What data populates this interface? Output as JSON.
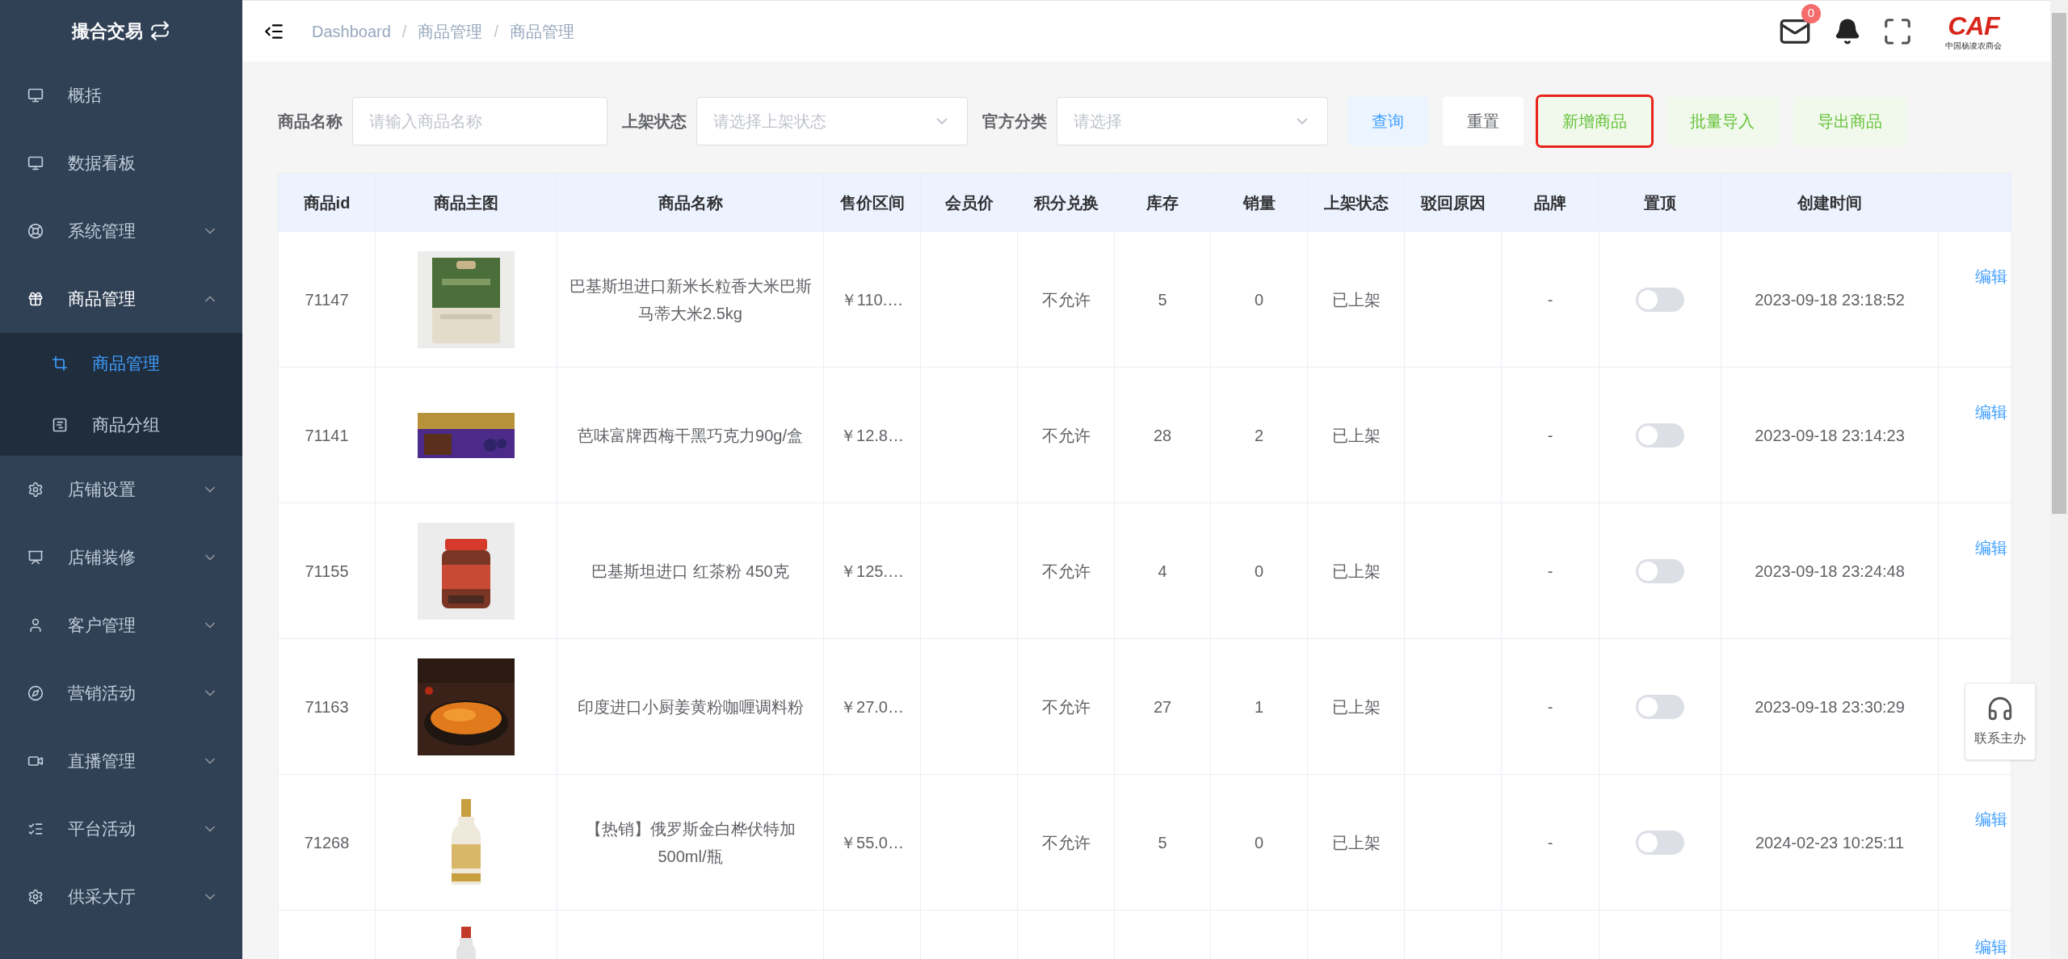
{
  "sidebar": {
    "title": "撮合交易",
    "items": [
      {
        "label": "概括",
        "expandable": false,
        "expanded": false
      },
      {
        "label": "数据看板",
        "expandable": false,
        "expanded": false
      },
      {
        "label": "系统管理",
        "expandable": true,
        "expanded": false
      },
      {
        "label": "商品管理",
        "expandable": true,
        "expanded": true,
        "children": [
          {
            "label": "商品管理",
            "selected": true
          },
          {
            "label": "商品分组",
            "selected": false
          }
        ]
      },
      {
        "label": "店铺设置",
        "expandable": true,
        "expanded": false
      },
      {
        "label": "店铺装修",
        "expandable": true,
        "expanded": false
      },
      {
        "label": "客户管理",
        "expandable": true,
        "expanded": false
      },
      {
        "label": "营销活动",
        "expandable": true,
        "expanded": false
      },
      {
        "label": "直播管理",
        "expandable": true,
        "expanded": false
      },
      {
        "label": "平台活动",
        "expandable": true,
        "expanded": false
      },
      {
        "label": "供采大厅",
        "expandable": true,
        "expanded": false
      }
    ]
  },
  "breadcrumb": {
    "separator": "/",
    "items": [
      "Dashboard",
      "商品管理",
      "商品管理"
    ]
  },
  "header": {
    "mail_badge": "0",
    "logo": "CAF",
    "logo_subtitle": "中国杨凌农商会"
  },
  "filters": [
    {
      "label": "商品名称",
      "placeholder": "请输入商品名称",
      "kind": "input"
    },
    {
      "label": "上架状态",
      "placeholder": "请选择上架状态",
      "kind": "select"
    },
    {
      "label": "官方分类",
      "placeholder": "请选择",
      "kind": "select"
    }
  ],
  "buttons": [
    {
      "label": "查询",
      "kind": "primary",
      "highlighted": false
    },
    {
      "label": "重置",
      "kind": "default",
      "highlighted": false
    },
    {
      "label": "新增商品",
      "kind": "success",
      "highlighted": true
    },
    {
      "label": "批量导入",
      "kind": "success",
      "highlighted": false
    },
    {
      "label": "导出商品",
      "kind": "success",
      "highlighted": false
    }
  ],
  "table": {
    "columns": [
      "商品id",
      "商品主图",
      "商品名称",
      "售价区间",
      "会员价",
      "积分兑换",
      "库存",
      "销量",
      "上架状态",
      "驳回原因",
      "品牌",
      "置顶",
      "创建时间"
    ],
    "rows": [
      {
        "id": "71147",
        "name": "巴基斯坦进口新米长粒香大米巴斯马蒂大米2.5kg",
        "price": "￥110.…",
        "points": "不允许",
        "stock": "5",
        "sales": "0",
        "status": "已上架",
        "brand": "-",
        "pinned": false,
        "created": "2023-09-18 23:18:52",
        "action": "编辑"
      },
      {
        "id": "71141",
        "name": "芭味富牌西梅干黑巧克力90g/盒",
        "price": "￥12.8…",
        "points": "不允许",
        "stock": "28",
        "sales": "2",
        "status": "已上架",
        "brand": "-",
        "pinned": false,
        "created": "2023-09-18 23:14:23",
        "action": "编辑"
      },
      {
        "id": "71155",
        "name": "巴基斯坦进口 红茶粉 450克",
        "price": "￥125.…",
        "points": "不允许",
        "stock": "4",
        "sales": "0",
        "status": "已上架",
        "brand": "-",
        "pinned": false,
        "created": "2023-09-18 23:24:48",
        "action": "编辑"
      },
      {
        "id": "71163",
        "name": "印度进口小厨姜黄粉咖喱调料粉",
        "price": "￥27.0…",
        "points": "不允许",
        "stock": "27",
        "sales": "1",
        "status": "已上架",
        "brand": "-",
        "pinned": false,
        "created": "2023-09-18 23:30:29"
      },
      {
        "id": "71268",
        "name": "【热销】俄罗斯金白桦伏特加 500ml/瓶",
        "price": "￥55.0…",
        "points": "不允许",
        "stock": "5",
        "sales": "0",
        "status": "已上架",
        "brand": "-",
        "pinned": false,
        "created": "2024-02-23 10:25:11",
        "action": "编辑"
      }
    ],
    "partial_row": {
      "action": "编辑"
    }
  },
  "help_widget": {
    "label": "联系主办"
  }
}
